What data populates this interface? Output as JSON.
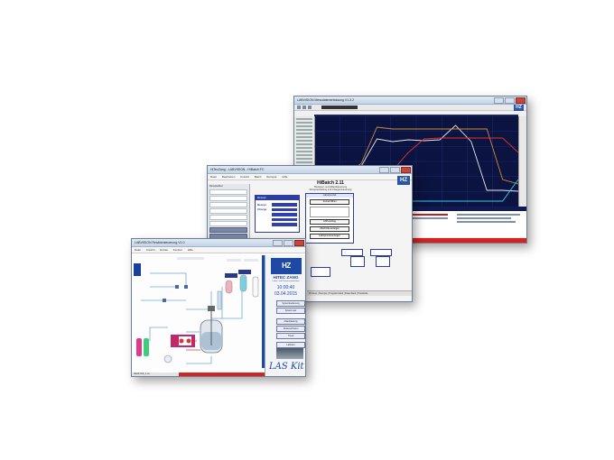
{
  "colors": {
    "chart_bg": "#0b1340",
    "brand_blue": "#1e4aa6",
    "alarm_red": "#d52222",
    "trace_orange": "#d08a3a",
    "trace_red": "#e03030",
    "trace_white": "#e8e8e8",
    "trace_cyan": "#38c8e8",
    "trace_green": "#40c040"
  },
  "window_chart": {
    "title": "LABVISION  Messdatenerfassung  V1.3.2",
    "logo": "HZ"
  },
  "window_hibatch": {
    "title": "HiTecZang - LABVISION - HiBatch  PC",
    "menu": [
      "Datei",
      "Bearbeiten",
      "Ansicht",
      "Batch",
      "Rezepte",
      "Hilfe"
    ],
    "app_title": "HiBatch 2.11",
    "subtitle_1": "Rezeptur- und Ablaufsteuerung",
    "subtitle_2": "Rezepterstellung und Chargensteuerung",
    "logo": "HZ",
    "left_header": "Rezepteditor",
    "recipe_pane_header": "Rezept",
    "recipe_pane_labels": [
      "Rezept",
      "Charge"
    ],
    "journal_header": "Laborjournal",
    "journal_buttons": [
      "Journal öffnen",
      "LIMS Auftrag",
      "Abschnitte anzeigen",
      "Laborjournal anzeigen",
      "LIMS"
    ],
    "left_button": "Chargenübersicht",
    "tabs": "Prozess | Rezepte | Programmlauf | Datenbank | Protokolle"
  },
  "window_reactor": {
    "title": "LABVISION  Reaktorsteuerung  V1.0",
    "menu": [
      "Datei",
      "Ansicht",
      "Extras",
      "Fenster",
      "Hilfe"
    ],
    "panel_logo": "HZ",
    "brand_name": "HITEC ZANG",
    "brand_sub": "Labor- und Prozessautomation",
    "clock": "10:00:40",
    "date": "03.04.2015",
    "panel_buttons": [
      "Systembedienung",
      "System aus",
      "Ablaufplanung",
      "Dosiereinheiten",
      "Trend",
      "LabCam"
    ],
    "footer_logo": "LAS Kit",
    "statusbar": "REAKTOR_1.vis"
  },
  "chart_data": {
    "type": "line",
    "title": "",
    "xlabel": "",
    "ylabel": "",
    "series": [
      {
        "values": [
          20,
          30,
          40,
          45,
          75,
          72,
          74,
          73,
          74,
          90,
          72,
          18,
          18,
          17
        ]
      },
      {
        "values": [
          20,
          25,
          35,
          48,
          88,
          86,
          86,
          86,
          86,
          86,
          86,
          86,
          30,
          25
        ]
      },
      {
        "values": [
          15,
          18,
          20,
          22,
          30,
          40,
          60,
          75,
          76,
          76,
          76,
          76,
          76,
          60
        ]
      },
      {
        "values": [
          5,
          5,
          6,
          6,
          6,
          6,
          6,
          6,
          6,
          6,
          6,
          6,
          6,
          30
        ]
      }
    ],
    "grid": true
  }
}
